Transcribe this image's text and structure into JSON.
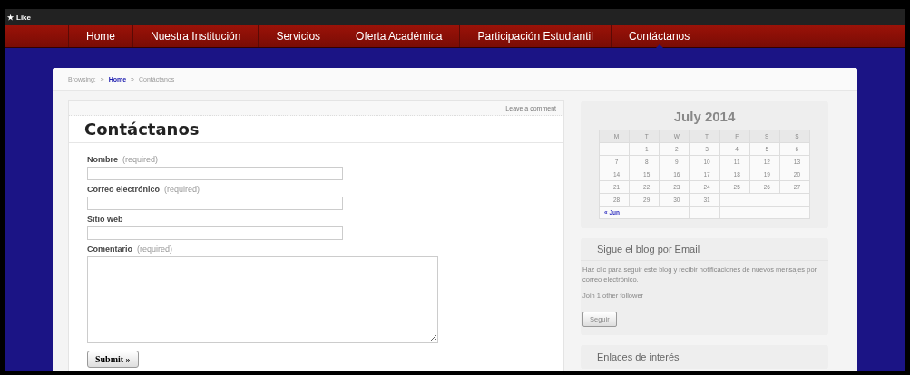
{
  "topbar": {
    "like_icon": "★",
    "like_label": "Like"
  },
  "nav": [
    {
      "label": "Home",
      "selected": false
    },
    {
      "label": "Nuestra Institución",
      "selected": false
    },
    {
      "label": "Servicios",
      "selected": false
    },
    {
      "label": "Oferta Académica",
      "selected": false
    },
    {
      "label": "Participación Estudiantil",
      "selected": false
    },
    {
      "label": "Contáctanos",
      "selected": true
    }
  ],
  "breadcrumb": {
    "prefix": "Browsing:",
    "items": [
      {
        "separator": "»",
        "label": "Home",
        "kind": "link"
      },
      {
        "separator": "»",
        "label": "Contáctanos",
        "kind": "current"
      }
    ]
  },
  "post": {
    "meta_link": "Leave a comment",
    "title": "Contáctanos",
    "fields": [
      {
        "label": "Nombre",
        "hint": "(required)",
        "kind": "input"
      },
      {
        "label": "Correo electrónico",
        "hint": "(required)",
        "kind": "input"
      },
      {
        "label": "Sitio web",
        "kind": "input"
      },
      {
        "label": "Comentario",
        "hint": "(required)",
        "kind": "textarea"
      }
    ],
    "submit": "Submit »"
  },
  "calendar": {
    "title": "July 2014",
    "weekdays": [
      "M",
      "T",
      "W",
      "T",
      "F",
      "S",
      "S"
    ],
    "weeks": [
      {
        "kind": "first",
        "days": [
          "1",
          "2",
          "3",
          "4",
          "5",
          "6"
        ]
      },
      {
        "kind": "full",
        "days": [
          "7",
          "8",
          "9",
          "10",
          "11",
          "12",
          "13"
        ]
      },
      {
        "kind": "full",
        "days": [
          "14",
          "15",
          "16",
          "17",
          "18",
          "19",
          "20"
        ]
      },
      {
        "kind": "full",
        "days": [
          "21",
          "22",
          "23",
          "24",
          "25",
          "26",
          "27"
        ]
      },
      {
        "kind": "last",
        "days": [
          "28",
          "29",
          "30",
          "31"
        ]
      }
    ],
    "prev_link": "« Jun"
  },
  "follow": {
    "title": "Sigue el blog por Email",
    "text": "Haz clic para seguir este blog y recibir notificaciones de nuevos mensajes por correo electrónico.",
    "followers": "Join 1 other follower",
    "button": "Seguir"
  },
  "next_widget": {
    "title": "Enlaces de interés"
  }
}
